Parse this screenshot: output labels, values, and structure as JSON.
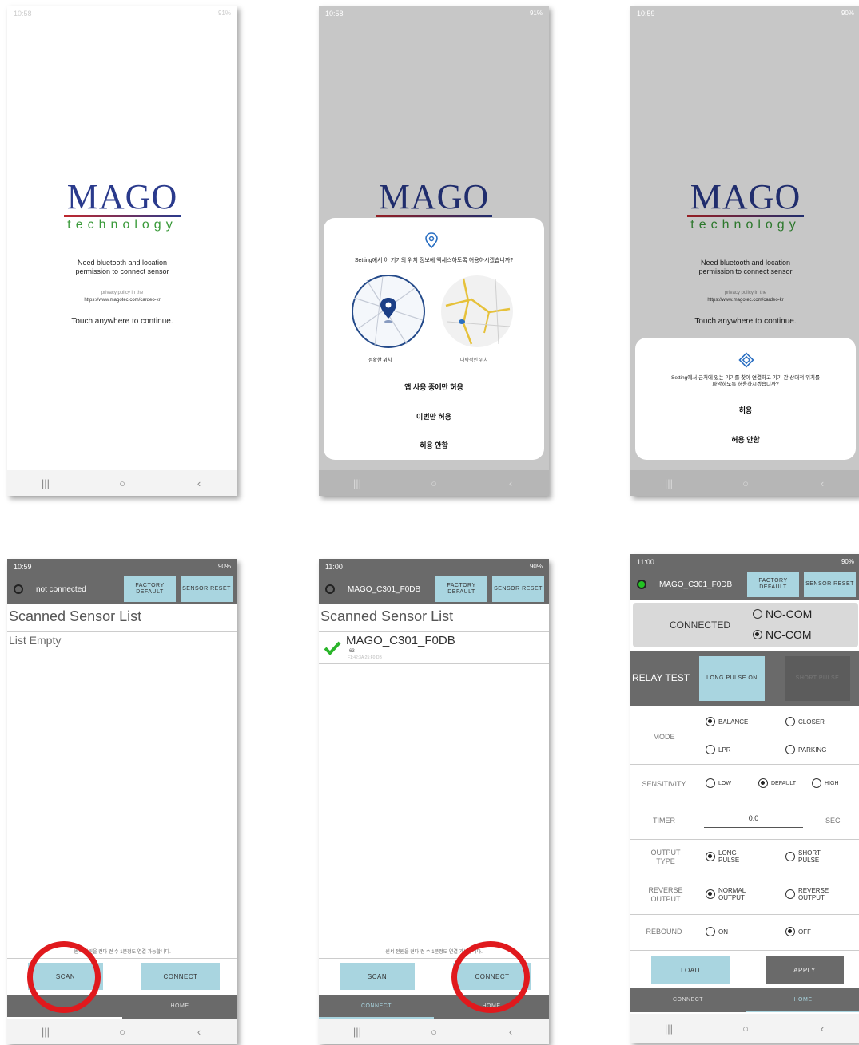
{
  "logo": {
    "mago": "MAGO",
    "tech": "technology"
  },
  "screen1": {
    "time": "10:58",
    "status_icons": "91%",
    "permission_text_1": "Need bluetooth and location",
    "permission_text_2": "permission to connect sensor",
    "privacy_label": "privacy policy in the",
    "privacy_url": "https://www.magotec.com/cardeo-kr",
    "continue_text": "Touch anywhere to continue."
  },
  "screen2": {
    "time": "10:58",
    "status_icons": "91%",
    "dialog_text": "Setting에서 이 기기의 위치 정보에 액세스하도록 허용하시겠습니까?",
    "precise_label": "정확한 위치",
    "approx_label": "대략적인 위치",
    "opt_while_using": "앱 사용 중에만 허용",
    "opt_once": "이번만 허용",
    "opt_deny": "허용 안함"
  },
  "screen3": {
    "time": "10:59",
    "status_icons": "90%",
    "dialog_text_1": "Setting에서 근처에 있는 기기를 찾아 연결하고 기기 간 상대적 위치를",
    "dialog_text_2": "파악하도록 허용하시겠습니까?",
    "opt_allow": "허용",
    "opt_deny": "허용 안함"
  },
  "screen4": {
    "time": "10:59",
    "status_icons": "90%",
    "device": "not connected",
    "factory_default": "FACTORY DEFAULT",
    "sensor_reset": "SENSOR RESET",
    "list_title": "Scanned Sensor List",
    "list_empty": "List Empty",
    "hint": "센서 전원을 켠다 켠 수 1분정도 연결 가능합니다.",
    "scan": "SCAN",
    "connect": "CONNECT",
    "tab_connect": "CONNECT",
    "tab_home": "HOME"
  },
  "screen5": {
    "time": "11:00",
    "status_icons": "90%",
    "device": "MAGO_C301_F0DB",
    "factory_default": "FACTORY DEFAULT",
    "sensor_reset": "SENSOR RESET",
    "list_title": "Scanned Sensor List",
    "item_name": "MAGO_C301_F0DB",
    "item_rssi": "-63",
    "item_mac": "F1:42:3A:25:F0:DB",
    "hint": "센서 전원을 켠다 켠 수 1분정도 연결 가능합니다.",
    "scan": "SCAN",
    "connect": "CONNECT",
    "tab_connect": "CONNECT",
    "tab_home": "HOME"
  },
  "screen6": {
    "time": "11:00",
    "status_icons": "90%",
    "device": "MAGO_C301_F0DB",
    "factory_default": "FACTORY DEFAULT",
    "sensor_reset": "SENSOR RESET",
    "connected": "CONNECTED",
    "no_com": "NO-COM",
    "nc_com": "NC-COM",
    "relay_test": "RELAY TEST",
    "long_pulse_on": "LONG PULSE ON",
    "short_pulse": "SHORT PULSE",
    "mode_label": "MODE",
    "mode_balance": "BALANCE",
    "mode_closer": "CLOSER",
    "mode_lpr": "LPR",
    "mode_parking": "PARKING",
    "sensitivity_label": "SENSITIVITY",
    "sens_low": "LOW",
    "sens_default": "DEFAULT",
    "sens_high": "HIGH",
    "timer_label": "TIMER",
    "timer_value": "0.0",
    "timer_unit": "SEC",
    "output_type_label": "OUTPUT TYPE",
    "out_long_pulse": "LONG PULSE",
    "out_short_pulse": "SHORT PULSE",
    "reverse_output_label": "REVERSE OUTPUT",
    "normal_output": "NORMAL OUTPUT",
    "reverse_output": "REVERSE OUTPUT",
    "rebound_label": "REBOUND",
    "rebound_on": "ON",
    "rebound_off": "OFF",
    "load": "LOAD",
    "apply": "APPLY",
    "tab_connect": "CONNECT",
    "tab_home": "HOME"
  },
  "colors": {
    "brand_blue": "#2a3a8c",
    "brand_green": "#3a9a3a",
    "button": "#a9d5e0",
    "header": "#6a6a6a",
    "highlight_circle": "#e0191d",
    "led_green": "#22c322"
  }
}
